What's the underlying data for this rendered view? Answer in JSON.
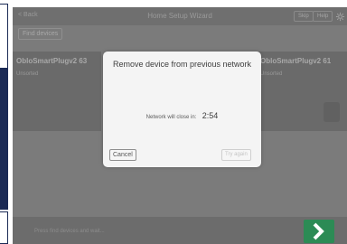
{
  "header": {
    "back_label": "< Back",
    "title": "Home Setup Wizard",
    "skip_label": "Skip",
    "help_label": "Help",
    "settings_icon": "gear-icon"
  },
  "toolbar": {
    "find_devices_label": "Find devices"
  },
  "devices": [
    {
      "name": "ObloSmartPlugv2 63",
      "status": "Unsorted"
    },
    {
      "name": "ObloSmartPlugv2 61",
      "status": "Unsorted"
    }
  ],
  "dialog": {
    "title": "Remove device from previous network",
    "countdown_label": "Network will close in:",
    "countdown_value": "2:54",
    "cancel_label": "Cancel",
    "try_again_label": "Try again"
  },
  "footer": {
    "hint": "Press find devices and wait...",
    "next_icon": "chevron-right-icon",
    "next_color": "#2c8b55"
  }
}
